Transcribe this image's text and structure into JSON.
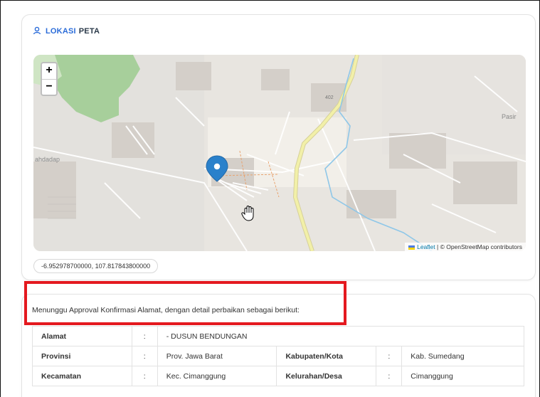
{
  "location_card": {
    "title_accent": "LOKASI",
    "title_rest": "PETA",
    "icon": "user-pin-icon"
  },
  "map": {
    "zoom_in": "+",
    "zoom_out": "−",
    "place_labels": [
      "Pasir",
      "ahdadap"
    ],
    "road_ref": "402",
    "attribution_link": "Leaflet",
    "attribution_rest": "| © OpenStreetMap contributors",
    "marker_icon": "map-marker-icon",
    "cursor_icon": "hand-cursor-icon"
  },
  "coordinates": "-6.952978700000, 107.817843800000",
  "confirmation": {
    "notice": "Menunggu Approval Konfirmasi Alamat, dengan detail perbaikan sebagai berikut:",
    "rows": [
      {
        "label": "Alamat",
        "sep": ":",
        "value": "- DUSUN BENDUNGAN"
      },
      {
        "label": "Provinsi",
        "sep": ":",
        "value": "Prov. Jawa Barat",
        "label2": "Kabupaten/Kota",
        "sep2": ":",
        "value2": "Kab. Sumedang"
      },
      {
        "label": "Kecamatan",
        "sep": ":",
        "value": "Kec. Cimanggung",
        "label2": "Kelurahan/Desa",
        "sep2": ":",
        "value2": "Cimanggung"
      }
    ]
  },
  "colors": {
    "accent": "#2b6cd9",
    "highlight_box": "#e4191f",
    "marker": "#2a81cb",
    "main_road": "#f2f0a8"
  }
}
